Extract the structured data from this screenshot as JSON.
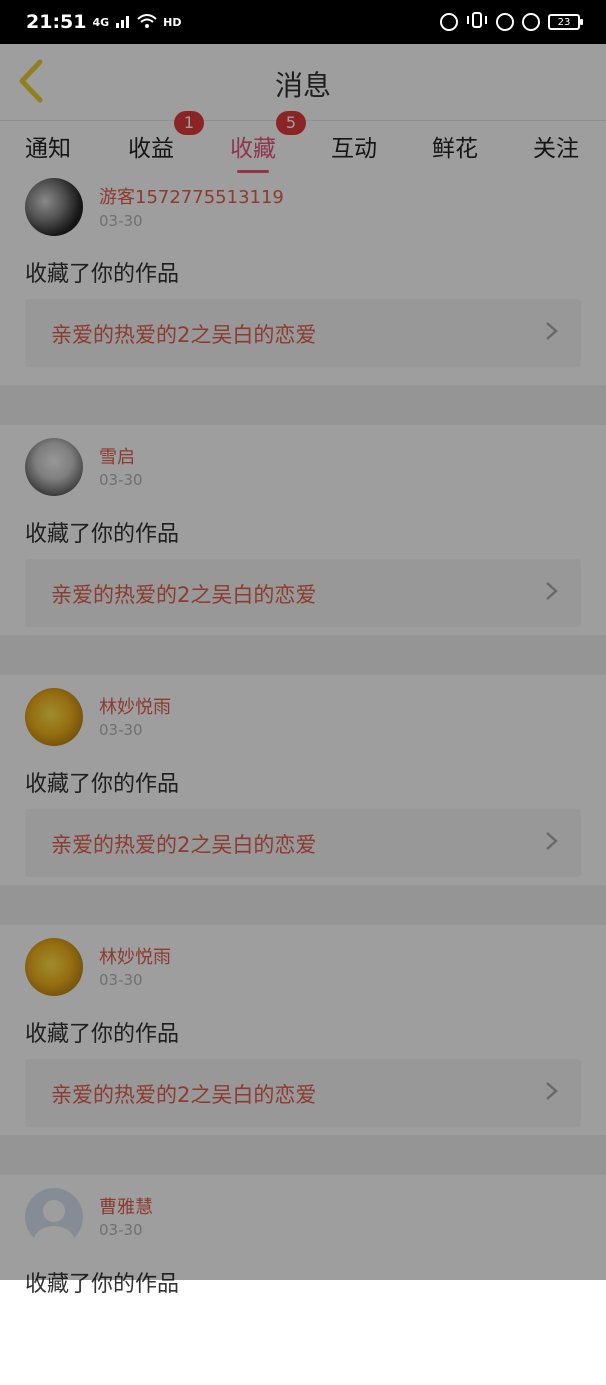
{
  "status_bar": {
    "time": "21:51",
    "net": "4G",
    "hd": "HD",
    "battery": "23"
  },
  "header": {
    "title": "消息"
  },
  "tabs": [
    {
      "label": "通知",
      "badge": ""
    },
    {
      "label": "收益",
      "badge": "1"
    },
    {
      "label": "收藏",
      "badge": "5",
      "active": true
    },
    {
      "label": "互动",
      "badge": ""
    },
    {
      "label": "鲜花",
      "badge": ""
    },
    {
      "label": "关注",
      "badge": ""
    }
  ],
  "items": [
    {
      "user": "游客1572775513119",
      "date": "03-30",
      "action": "收藏了你的作品",
      "work": "亲爱的热爱的2之吴白的恋爱"
    },
    {
      "user": "雪启",
      "date": "03-30",
      "action": "收藏了你的作品",
      "work": "亲爱的热爱的2之吴白的恋爱"
    },
    {
      "user": "林妙悦雨",
      "date": "03-30",
      "action": "收藏了你的作品",
      "work": "亲爱的热爱的2之吴白的恋爱"
    },
    {
      "user": "林妙悦雨",
      "date": "03-30",
      "action": "收藏了你的作品",
      "work": "亲爱的热爱的2之吴白的恋爱"
    },
    {
      "user": "曹雅慧",
      "date": "03-30",
      "action": "收藏了你的作品",
      "work": ""
    }
  ],
  "colors": {
    "accent": "#e4577f",
    "name": "#e3604e",
    "badge": "#e03a3a"
  }
}
